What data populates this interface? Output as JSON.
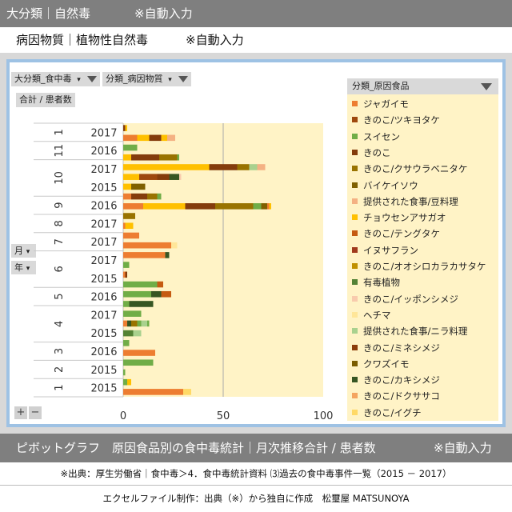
{
  "header": {
    "category": "大分類｜自然毒",
    "category_note": "※自動入力",
    "subcategory": "病因物質｜植物性自然毒",
    "subcategory_note": "※自動入力"
  },
  "pivot": {
    "filter1": "大分類_食中毒",
    "filter2": "分類_病因物質",
    "value_field": "合計 / 患者数",
    "axis_field_month": "月",
    "axis_field_year": "年",
    "legend_field": "分類_原因食品",
    "expand_button": "+",
    "collapse_button": "−"
  },
  "colors": {
    "plot_bg": "#fff3c6",
    "frame": "#9ec2e4"
  },
  "chart_data": {
    "type": "bar",
    "orientation": "horizontal",
    "stacked": true,
    "xlim": [
      0,
      100
    ],
    "xticks": [
      0,
      50,
      100
    ],
    "vertical_gridline_at": 50,
    "legend_position": "right",
    "month_groups": [
      {
        "month": "1",
        "rows": 1
      },
      {
        "month": "11",
        "rows": 1
      },
      {
        "month": "10",
        "rows": 2
      },
      {
        "month": "9",
        "rows": 1
      },
      {
        "month": "8",
        "rows": 1
      },
      {
        "month": "7",
        "rows": 1
      },
      {
        "month": "6",
        "rows": 2
      },
      {
        "month": "5",
        "rows": 1
      },
      {
        "month": "4",
        "rows": 2
      },
      {
        "month": "3",
        "rows": 1
      },
      {
        "month": "2",
        "rows": 1
      },
      {
        "month": "1",
        "rows": 1
      }
    ],
    "categories": [
      "2017",
      "2016",
      "2017",
      "2015",
      "2016",
      "2017",
      "2017",
      "2017",
      "2015",
      "2016",
      "2017",
      "2015",
      "2016",
      "2015",
      "2015"
    ],
    "series": [
      {
        "name": "ジャガイモ",
        "color": "#ed7d31",
        "values": [
          0,
          0,
          0,
          0,
          0,
          0,
          8,
          0,
          0,
          0,
          0,
          0,
          0,
          0,
          30
        ]
      },
      {
        "name": "きのこ/ツキヨタケ",
        "color": "#9e480e",
        "values": [
          0,
          0,
          0,
          0,
          0,
          0,
          0,
          0,
          0,
          0,
          0,
          0,
          0,
          0,
          0
        ]
      },
      {
        "name": "スイセン",
        "color": "#70ad47",
        "values": [
          0,
          7,
          0,
          0,
          0,
          0,
          0,
          0,
          3,
          18,
          10,
          3,
          15,
          0,
          0
        ]
      },
      {
        "name": "きのこ",
        "color": "#843c0c",
        "values": [
          1,
          0,
          0,
          0,
          0,
          0,
          0,
          0,
          0,
          0,
          0,
          0,
          0,
          0,
          0
        ]
      },
      {
        "name": "きのこ/クサウラベニタケ",
        "color": "#997300",
        "values": [
          0,
          0,
          0,
          0,
          0,
          0,
          0,
          0,
          0,
          0,
          0,
          0,
          0,
          0,
          0
        ]
      },
      {
        "name": "バイケイソウ",
        "color": "#7f6000",
        "values": [
          0,
          0,
          0,
          0,
          0,
          0,
          0,
          0,
          0,
          0,
          0,
          0,
          0,
          0,
          0
        ]
      },
      {
        "name": "提供された食事/豆料理",
        "color": "#f4b183",
        "values": [
          0,
          0,
          0,
          0,
          0,
          0,
          0,
          0,
          0,
          0,
          0,
          0,
          0,
          0,
          0
        ]
      },
      {
        "name": "チョウセンアサガオ",
        "color": "#ffc000",
        "values": [
          1,
          6,
          43,
          8,
          31,
          0,
          0,
          2,
          0,
          0,
          0,
          0,
          0,
          1,
          4
        ]
      },
      {
        "name": "きのこ/テングタケ",
        "color": "#c55a11",
        "values": [
          0,
          0,
          0,
          0,
          0,
          0,
          0,
          0,
          0,
          0,
          0,
          0,
          0,
          0,
          0
        ]
      },
      {
        "name": "イヌサフラン",
        "color": "#a0391c",
        "values": [
          0,
          0,
          0,
          0,
          0,
          0,
          0,
          0,
          0,
          0,
          0,
          0,
          0,
          0,
          0
        ]
      },
      {
        "name": "きのこ/オオシロカラカサタケ",
        "color": "#bf9000",
        "values": [
          0,
          0,
          0,
          0,
          0,
          0,
          0,
          0,
          0,
          0,
          0,
          0,
          0,
          0,
          0
        ]
      },
      {
        "name": "有毒植物",
        "color": "#548235",
        "values": [
          0,
          0,
          0,
          0,
          0,
          0,
          0,
          0,
          0,
          0,
          0,
          0,
          0,
          0,
          0
        ]
      },
      {
        "name": "きのこ/イッポンシメジ",
        "color": "#f8cbad",
        "values": [
          0,
          0,
          0,
          0,
          0,
          0,
          0,
          0,
          0,
          0,
          0,
          0,
          0,
          0,
          0
        ]
      },
      {
        "name": "ヘチマ",
        "color": "#ffe699",
        "values": [
          0,
          0,
          0,
          0,
          0,
          0,
          0,
          0,
          0,
          0,
          0,
          0,
          0,
          0,
          0
        ]
      },
      {
        "name": "提供された食事/ニラ料理",
        "color": "#a9d18e",
        "values": [
          0,
          0,
          0,
          0,
          0,
          0,
          0,
          0,
          0,
          0,
          0,
          0,
          0,
          0,
          0
        ]
      },
      {
        "name": "きのこ/ミネシメジ",
        "color": "#8b3d0a",
        "values": [
          0,
          0,
          0,
          0,
          0,
          0,
          0,
          0,
          0,
          0,
          0,
          0,
          0,
          0,
          0
        ]
      },
      {
        "name": "クワズイモ",
        "color": "#7a5c00",
        "values": [
          0,
          0,
          0,
          0,
          0,
          0,
          0,
          0,
          0,
          0,
          0,
          0,
          0,
          0,
          0
        ]
      },
      {
        "name": "きのこ/カキシメジ",
        "color": "#375623",
        "values": [
          0,
          0,
          0,
          0,
          0,
          0,
          0,
          0,
          0,
          0,
          0,
          0,
          0,
          0,
          0
        ]
      },
      {
        "name": "きのこ/ドクササコ",
        "color": "#f4a460",
        "values": [
          0,
          0,
          0,
          0,
          0,
          0,
          0,
          0,
          0,
          0,
          0,
          0,
          0,
          0,
          0
        ]
      },
      {
        "name": "きのこ/イグチ",
        "color": "#ffd966",
        "values": [
          0,
          0,
          0,
          0,
          0,
          0,
          0,
          0,
          0,
          0,
          0,
          0,
          0,
          0,
          0
        ]
      }
    ],
    "stacks": [
      [
        [
          "#843c0c",
          1
        ],
        [
          "#ffc000",
          1
        ]
      ],
      [
        [
          "#ed7d31",
          7
        ],
        [
          "#ffc000",
          6
        ],
        [
          "#843c0c",
          6
        ],
        [
          "#ffc000",
          3
        ],
        [
          "#f4b183",
          4
        ]
      ],
      [
        [
          "#70ad47",
          7
        ]
      ],
      [
        [
          "#ffc000",
          4
        ],
        [
          "#843c0c",
          14
        ],
        [
          "#997300",
          9
        ],
        [
          "#70ad47",
          1
        ]
      ],
      [
        [
          "#ffc000",
          43
        ],
        [
          "#843c0c",
          14
        ],
        [
          "#997300",
          6
        ],
        [
          "#a9d18e",
          4
        ],
        [
          "#f4b183",
          4
        ]
      ],
      [
        [
          "#ffc000",
          8
        ],
        [
          "#9e480e",
          9
        ],
        [
          "#843c0c",
          6
        ],
        [
          "#375623",
          5
        ],
        [
          "#f8cbad",
          1
        ]
      ],
      [
        [
          "#ffc000",
          4
        ],
        [
          "#7f6000",
          7
        ]
      ],
      [
        [
          "#ed7d31",
          4
        ],
        [
          "#843c0c",
          8
        ],
        [
          "#997300",
          5
        ],
        [
          "#70ad47",
          2
        ]
      ],
      [
        [
          "#ed7d31",
          10
        ],
        [
          "#ffc000",
          21
        ],
        [
          "#843c0c",
          15
        ],
        [
          "#997300",
          19
        ],
        [
          "#70ad47",
          4
        ],
        [
          "#7f6000",
          3
        ],
        [
          "#ed7d31",
          1
        ],
        [
          "#ffc000",
          1
        ]
      ],
      [
        [
          "#997300",
          6
        ]
      ],
      [
        [
          "#ed7d31",
          1
        ],
        [
          "#ffc000",
          4
        ]
      ],
      [
        [
          "#ed7d31",
          8
        ]
      ],
      [
        [
          "#ed7d31",
          24
        ],
        [
          "#ffe699",
          3
        ]
      ],
      [
        [
          "#ed7d31",
          21
        ],
        [
          "#375623",
          2
        ]
      ],
      [
        [
          "#70ad47",
          3
        ]
      ],
      [
        [
          "#ed7d31",
          1
        ],
        [
          "#843c0c",
          1
        ]
      ],
      [
        [
          "#70ad47",
          17
        ],
        [
          "#c55a11",
          3
        ]
      ],
      [
        [
          "#70ad47",
          14
        ],
        [
          "#375623",
          5
        ],
        [
          "#c55a11",
          5
        ]
      ],
      [
        [
          "#70ad47",
          3
        ],
        [
          "#375623",
          12
        ]
      ],
      [
        [
          "#70ad47",
          9
        ]
      ],
      [
        [
          "#ed7d31",
          2
        ],
        [
          "#375623",
          2
        ],
        [
          "#997300",
          3
        ],
        [
          "#70ad47",
          2
        ],
        [
          "#a9d18e",
          3
        ],
        [
          "#70ad47",
          1
        ]
      ],
      [
        [
          "#548235",
          5
        ],
        [
          "#a9d18e",
          4
        ]
      ],
      [
        [
          "#70ad47",
          3
        ]
      ],
      [
        [
          "#ed7d31",
          16
        ]
      ],
      [
        [
          "#70ad47",
          15
        ]
      ],
      [
        [
          "#70ad47",
          1
        ]
      ],
      [
        [
          "#70ad47",
          2
        ],
        [
          "#ffc000",
          2
        ]
      ],
      [
        [
          "#ed7d31",
          30
        ],
        [
          "#ffd966",
          4
        ]
      ]
    ]
  },
  "footer": {
    "chart_title": "ピボットグラフ　原因食品別の食中毒統計｜月次推移合計 / 患者数",
    "chart_title_note": "※自動入力",
    "source": "※出典：厚生労働省｜食中毒＞4．食中毒統計資料 ⑶過去の食中毒事件一覧（2015 － 2017）",
    "credit": "エクセルファイル制作：出典（※）から独自に作成　松璽屋 MATSUNOYA"
  }
}
